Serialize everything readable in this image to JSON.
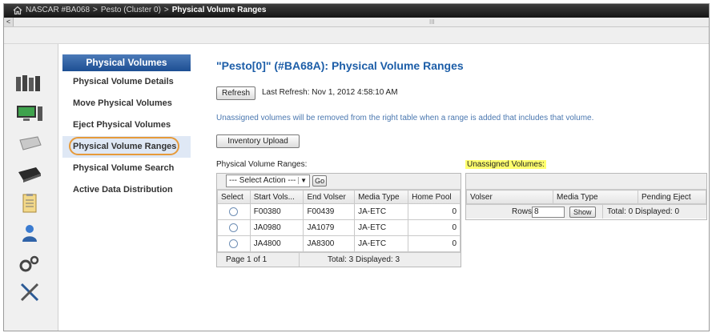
{
  "breadcrumb": [
    "NASCAR #BA068",
    "Pesto (Cluster 0)",
    "Physical Volume Ranges"
  ],
  "breadcrumb_separator": ">",
  "scrollbar_grip": "III",
  "scroll_left_arrow": "<",
  "nav": {
    "header": "Physical Volumes",
    "items": [
      {
        "label": "Physical Volume Details"
      },
      {
        "label": "Move Physical Volumes"
      },
      {
        "label": "Eject Physical Volumes"
      },
      {
        "label": "Physical Volume Ranges",
        "active": true
      },
      {
        "label": "Physical Volume Search"
      },
      {
        "label": "Active Data Distribution"
      }
    ]
  },
  "iconbar": [
    "servers-icon",
    "monitor-icon",
    "drive-icon",
    "tape-drive-icon",
    "clipboard-icon",
    "user-icon",
    "gears-icon",
    "tools-icon"
  ],
  "main": {
    "title": "\"Pesto[0]\" (#BA68A): Physical Volume Ranges",
    "refresh_label": "Refresh",
    "last_refresh": "Last Refresh:  Nov 1, 2012 4:58:10 AM",
    "info_text": "Unassigned volumes will be removed from the right table when a range is added that includes that volume.",
    "inventory_upload_label": "Inventory Upload"
  },
  "ranges": {
    "label": "Physical Volume Ranges:",
    "select_action": "--- Select Action ---",
    "go_label": "Go",
    "columns": [
      "Select",
      "Start Vols...",
      "End Volser",
      "Media Type",
      "Home Pool"
    ],
    "rows": [
      {
        "start": "F00380",
        "end": "F00439",
        "media": "JA-ETC",
        "pool": "0"
      },
      {
        "start": "JA0980",
        "end": "JA1079",
        "media": "JA-ETC",
        "pool": "0"
      },
      {
        "start": "JA4800",
        "end": "JA8300",
        "media": "JA-ETC",
        "pool": "0"
      }
    ],
    "footer_page": "Page 1 of 1",
    "footer_total": "Total: 3   Displayed: 3"
  },
  "unassigned": {
    "label": "Unassigned Volumes:",
    "columns": [
      "Volser",
      "Media Type",
      "Pending Eject"
    ],
    "rows_label": "Rows:",
    "rows_value": "8",
    "show_label": "Show",
    "footer_total": "Total: 0   Displayed: 0"
  }
}
